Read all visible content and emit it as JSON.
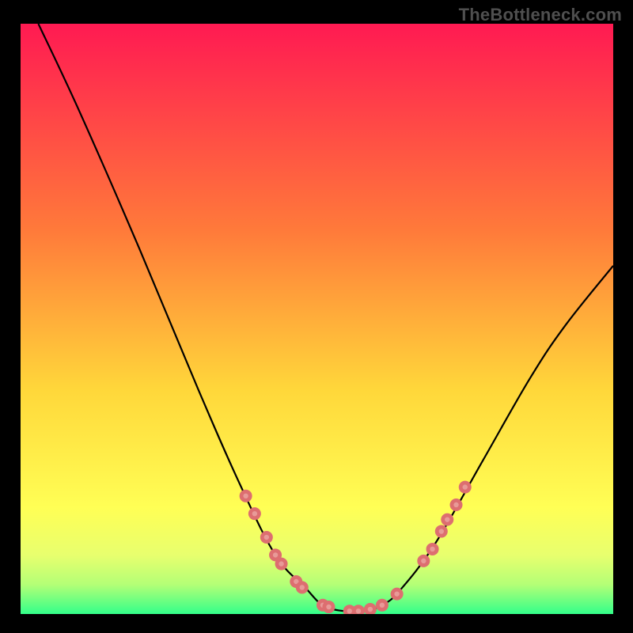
{
  "attribution": "TheBottleneck.com",
  "colors": {
    "background": "#000000",
    "attribution_text": "#4f4f4f",
    "gradient_top": "#ff1a52",
    "gradient_mid1": "#ff7a3a",
    "gradient_mid2": "#ffd73a",
    "gradient_low1": "#ffff55",
    "gradient_low2": "#e8ff6e",
    "gradient_low3": "#b4ff76",
    "gradient_bottom": "#33ff8a",
    "curve": "#000000",
    "marker_outer": "#dd6e70",
    "marker_inner": "#e89a98"
  },
  "chart_data": {
    "type": "line",
    "title": "",
    "xlabel": "",
    "ylabel": "",
    "xlim": [
      0,
      100
    ],
    "ylim": [
      0,
      100
    ],
    "legend": false,
    "grid": false,
    "series": [
      {
        "name": "bottleneck-curve",
        "x": [
          3,
          10,
          20,
          30,
          37,
          43,
          48,
          51,
          54.5,
          58,
          61,
          64,
          70,
          78,
          86,
          92,
          100
        ],
        "y": [
          100,
          85,
          62,
          38,
          22,
          10,
          4.5,
          1.5,
          0.5,
          0.5,
          1.5,
          4,
          12,
          26,
          40,
          49,
          59
        ]
      }
    ],
    "markers": [
      {
        "name": "left-cluster",
        "x": 38.0,
        "y": 20.0
      },
      {
        "name": "left-cluster",
        "x": 39.5,
        "y": 17.0
      },
      {
        "name": "left-cluster",
        "x": 41.5,
        "y": 13.0
      },
      {
        "name": "left-cluster",
        "x": 43.0,
        "y": 10.0
      },
      {
        "name": "left-cluster",
        "x": 44.0,
        "y": 8.5
      },
      {
        "name": "left-cluster",
        "x": 46.5,
        "y": 5.5
      },
      {
        "name": "left-cluster",
        "x": 47.5,
        "y": 4.5
      },
      {
        "name": "bottom",
        "x": 51.0,
        "y": 1.5
      },
      {
        "name": "bottom",
        "x": 52.0,
        "y": 1.2
      },
      {
        "name": "bottom",
        "x": 55.5,
        "y": 0.5
      },
      {
        "name": "bottom",
        "x": 57.0,
        "y": 0.5
      },
      {
        "name": "bottom",
        "x": 59.0,
        "y": 0.8
      },
      {
        "name": "bottom",
        "x": 61.0,
        "y": 1.5
      },
      {
        "name": "bottom",
        "x": 63.5,
        "y": 3.4
      },
      {
        "name": "right-cluster",
        "x": 68.0,
        "y": 9.0
      },
      {
        "name": "right-cluster",
        "x": 69.5,
        "y": 11.0
      },
      {
        "name": "right-cluster",
        "x": 71.0,
        "y": 14.0
      },
      {
        "name": "right-cluster",
        "x": 72.0,
        "y": 16.0
      },
      {
        "name": "right-cluster",
        "x": 73.5,
        "y": 18.5
      },
      {
        "name": "right-cluster",
        "x": 75.0,
        "y": 21.5
      }
    ],
    "annotations": []
  }
}
